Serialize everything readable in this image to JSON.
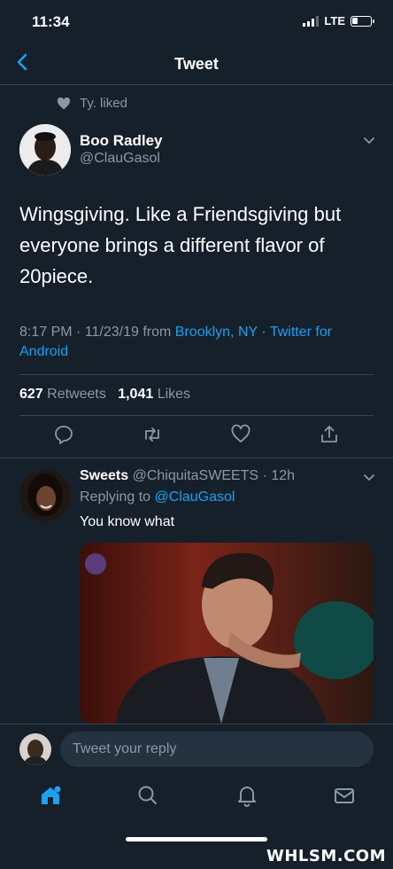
{
  "status": {
    "time": "11:34",
    "network": "LTE"
  },
  "nav": {
    "title": "Tweet"
  },
  "context": {
    "text": "Ty. liked"
  },
  "tweet": {
    "author_name": "Boo Radley",
    "author_handle": "@ClauGasol",
    "text": "Wingsgiving. Like a Friendsgiving but everyone brings a different flavor of 20piece.",
    "time": "8:17 PM · 11/23/19 from",
    "location": "Brooklyn, NY",
    "sep": " · ",
    "client": "Twitter for Android",
    "retweets": "627",
    "retweets_label": "Retweets",
    "likes": "1,041",
    "likes_label": "Likes"
  },
  "reply": {
    "name": "Sweets",
    "handle": "@ChiquitaSWEETS",
    "age": "· 12h",
    "replying_prefix": "Replying to",
    "replying_handle": "@ClauGasol",
    "text": "You know what"
  },
  "composer": {
    "placeholder": "Tweet your reply"
  },
  "tabs": [
    "home-icon",
    "search-icon",
    "notifications-icon",
    "messages-icon"
  ],
  "watermark": "WHLSM.COM",
  "colors": {
    "background": "#15202b",
    "link": "#1da1f2",
    "muted": "#8899a6",
    "divider": "#38444d"
  }
}
